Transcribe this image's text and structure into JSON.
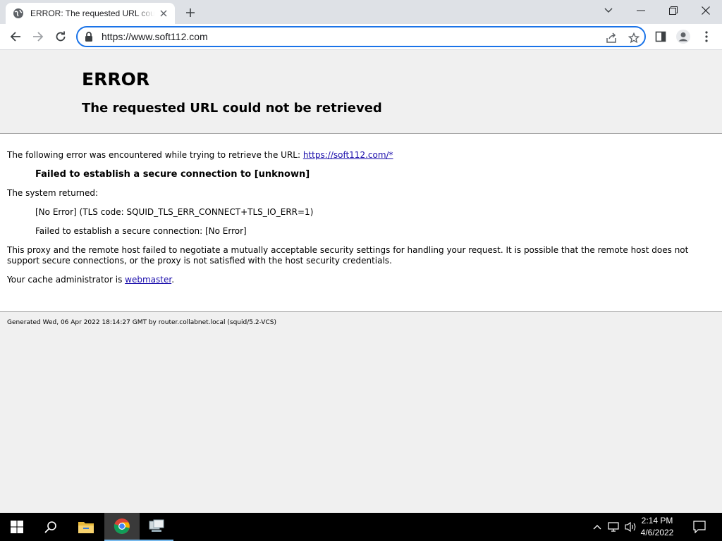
{
  "browser": {
    "tab_title": "ERROR: The requested URL could not be retrieved",
    "url": "https://www.soft112.com"
  },
  "page": {
    "heading": "ERROR",
    "subheading": "The requested URL could not be retrieved",
    "intro_text": "The following error was encountered while trying to retrieve the URL: ",
    "intro_link": "https://soft112.com/*",
    "error_title": "Failed to establish a secure connection to [unknown]",
    "system_returned": "The system returned:",
    "tls_code": "[No Error] (TLS code: SQUID_TLS_ERR_CONNECT+TLS_IO_ERR=1)",
    "secure_conn": "Failed to establish a secure connection: [No Error]",
    "explanation_line1": "This proxy and the remote host failed to negotiate a mutually acceptable security settings for handling your request. It is possible that the remote host does not",
    "explanation_line2": "support secure connections, or the proxy is not satisfied with the host security credentials.",
    "admin_text": "Your cache administrator is ",
    "admin_link": "webmaster",
    "admin_suffix": ".",
    "footer": "Generated Wed, 06 Apr 2022 18:14:27 GMT by router.collabnet.local (squid/5.2-VCS)"
  },
  "taskbar": {
    "time": "2:14 PM",
    "date": "4/6/2022"
  },
  "icons": {
    "favicon": "globe-icon",
    "tab_close": "close-icon",
    "new_tab": "plus-icon",
    "back": "arrow-left-icon",
    "forward": "arrow-right-icon",
    "reload": "reload-icon",
    "lock": "lock-icon",
    "share": "share-icon",
    "bookmark": "star-icon",
    "side_panel": "side-panel-icon",
    "profile": "profile-icon",
    "menu": "kebab-menu-icon"
  }
}
